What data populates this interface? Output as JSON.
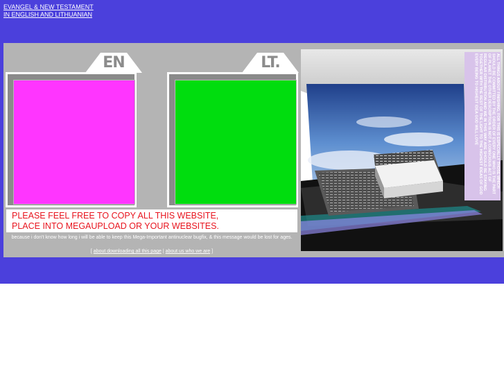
{
  "header": {
    "title_line1": "EVANGEL & NEW TESTAMENT",
    "title_line2": "IN ENGLISH AND LITHUANIAN"
  },
  "languages": {
    "en": {
      "label": "EN",
      "color": "#ff35ff"
    },
    "lt": {
      "label": "LT.",
      "color": "#00dd0e"
    }
  },
  "notice": {
    "line1": "PLEASE FEEL FREE TO COPY ALL THIS WEBSITE,",
    "line2": "PLACE INTO MEGAUPLOAD OR YOUR WEBSITES."
  },
  "subtext": "because i don't know how long i will be able to keep this Mega-Important antinuclear bugfix, & this message would be lost for ages.",
  "links": {
    "bracket_open": "[ ",
    "about_download": "about downloading all this page",
    "separator": " | ",
    "about_us": "about us who we are",
    "bracket_close": " ]"
  },
  "photo": {
    "vertical_text": "ALL THINGS ABOUT FINISHING, FOR THIS IS ESPECIALLY THOSE WHICH SHOULD BE COMMITTED BY THE ORDER OF EVERY ONE WHO IS THE PART OF PLANET THE OTHER DESCRIPTION IS NOT A CONSCIOUS ACT OF REGULAR DISTRIBUTION AND WE IN THIS WAY ARE SHOULD BE STAYING TOGETHER WITH THE REST OF THE LIGHT TO THE HIGHEST IDEAS OF GOD EVERY BEING TO HIGHEST IDEA GOD WILL LOVE"
  }
}
